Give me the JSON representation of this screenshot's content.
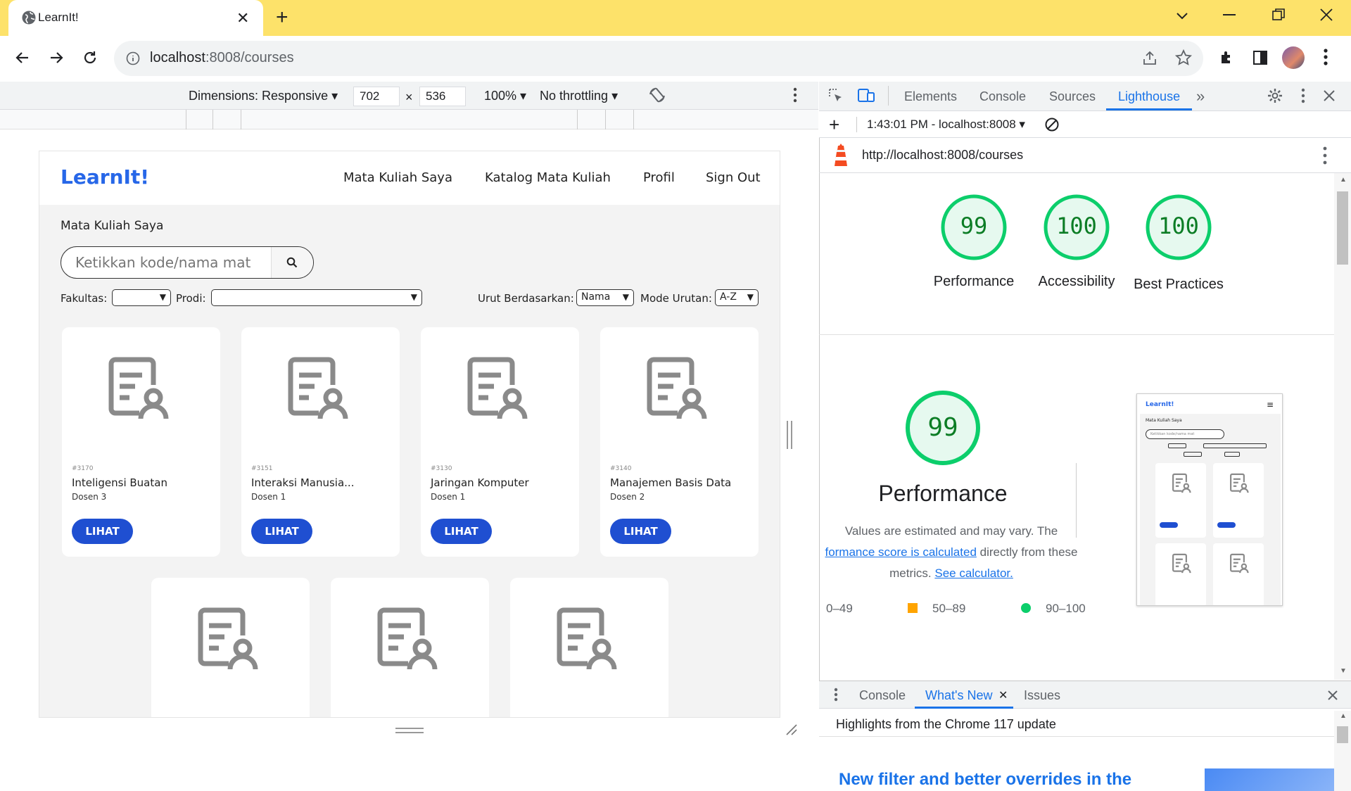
{
  "browser": {
    "tab_title": "LearnIt!",
    "url_host": "localhost",
    "url_path": ":8008/courses"
  },
  "device_toolbar": {
    "dimensions_label": "Dimensions: Responsive",
    "width": "702",
    "height": "536",
    "zoom": "100%",
    "throttling": "No throttling",
    "times": "×"
  },
  "site": {
    "brand": "LearnIt!",
    "nav": [
      "Mata Kuliah Saya",
      "Katalog Mata Kuliah",
      "Profil",
      "Sign Out"
    ],
    "page_title": "Mata Kuliah Saya",
    "search_placeholder": "Ketikkan kode/nama mat",
    "filters": {
      "fakultas_label": "Fakultas:",
      "prodi_label": "Prodi:",
      "sort_label": "Urut Berdasarkan:",
      "sort_value": "Nama",
      "order_label": "Mode Urutan:",
      "order_value": "A-Z"
    },
    "cards": [
      {
        "code": "#3170",
        "name": "Inteligensi Buatan",
        "dosen": "Dosen 3",
        "button": "LIHAT"
      },
      {
        "code": "#3151",
        "name": "Interaksi Manusia...",
        "dosen": "Dosen 1",
        "button": "LIHAT"
      },
      {
        "code": "#3130",
        "name": "Jaringan Komputer",
        "dosen": "Dosen 1",
        "button": "LIHAT"
      },
      {
        "code": "#3140",
        "name": "Manajemen Basis Data",
        "dosen": "Dosen 2",
        "button": "LIHAT"
      }
    ]
  },
  "devtools": {
    "tabs": [
      "Elements",
      "Console",
      "Sources",
      "Lighthouse"
    ],
    "active_tab": "Lighthouse",
    "report_time": "1:43:01 PM - localhost:8008",
    "report_url": "http://localhost:8008/courses",
    "scores": [
      {
        "label": "Performance",
        "value": "99"
      },
      {
        "label": "Accessibility",
        "value": "100"
      },
      {
        "label": "Best Practices",
        "value": "100"
      }
    ],
    "perf_section": {
      "score": "99",
      "title": "Performance",
      "desc_part1": "Values are estimated and may vary. The",
      "desc_link1": "formance score is calculated",
      "desc_part2": " directly from these",
      "desc_part3": "metrics.",
      "desc_link2": "See calculator.",
      "legend": [
        "0–49",
        "50–89",
        "90–100"
      ]
    },
    "thumbnail": {
      "brand": "LearnIt!",
      "title": "Mata Kuliah Saya",
      "search": "Ketikkan kode/nama mat"
    },
    "drawer_tabs": [
      "Console",
      "What's New",
      "Issues"
    ],
    "drawer_active": "What's New",
    "drawer_highlight": "Highlights from the Chrome 117 update",
    "drawer_headline": "New filter and better overrides in the"
  },
  "colors": {
    "titlebar": "#fde26a",
    "brand": "#2767e8",
    "button": "#1f4fd1",
    "score_green": "#0cce6b",
    "score_orange": "#ffa400"
  }
}
